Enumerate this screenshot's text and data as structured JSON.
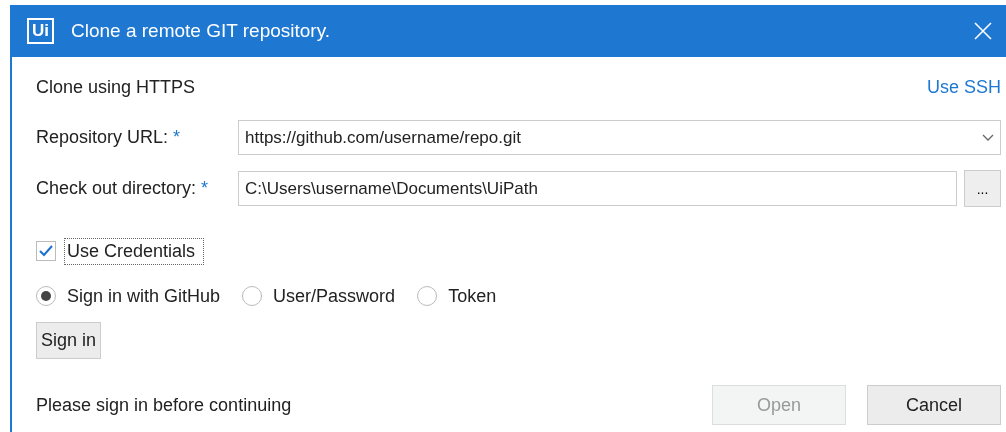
{
  "window": {
    "title": "Clone a remote GIT repository.",
    "logo": "Ui"
  },
  "mode": {
    "label": "Clone using HTTPS",
    "switch_link": "Use SSH"
  },
  "fields": [
    {
      "kind": "combo",
      "label": "Repository URL:",
      "required_mark": "*",
      "value": "https://github.com/username/repo.git"
    },
    {
      "kind": "browse",
      "label": "Check out directory:",
      "required_mark": "*",
      "value": "C:\\Users\\username\\Documents\\UiPath",
      "button": "..."
    }
  ],
  "credentials": {
    "label": "Use Credentials",
    "checked": true,
    "focused": true
  },
  "auth_options": [
    {
      "label": "Sign in with GitHub",
      "selected": true
    },
    {
      "label": "User/Password",
      "selected": false
    },
    {
      "label": "Token",
      "selected": false
    }
  ],
  "sign_in_button": "Sign in",
  "status": "Please sign in before continuing",
  "buttons": [
    {
      "label": "Open",
      "disabled": true
    },
    {
      "label": "Cancel",
      "disabled": false
    }
  ]
}
